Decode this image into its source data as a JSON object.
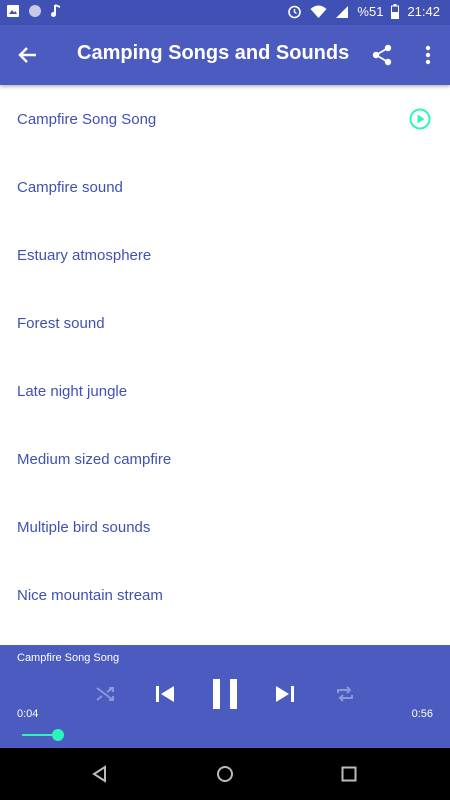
{
  "status_bar": {
    "battery_percent": "%51",
    "time": "21:42"
  },
  "app_bar": {
    "title": "Camping Songs and Sounds"
  },
  "list": {
    "items": [
      {
        "label": "Campfire Song Song",
        "playing": true
      },
      {
        "label": "Campfire sound"
      },
      {
        "label": "Estuary atmosphere"
      },
      {
        "label": "Forest sound"
      },
      {
        "label": "Late night jungle"
      },
      {
        "label": "Medium sized campfire"
      },
      {
        "label": "Multiple bird sounds"
      },
      {
        "label": "Nice mountain stream"
      }
    ]
  },
  "player": {
    "now_playing": "Campfire Song Song",
    "elapsed": "0:04",
    "duration": "0:56",
    "progress_fraction": 0.087
  },
  "colors": {
    "primary": "#4b5bbf",
    "text": "#3f51b5",
    "accent": "#2bf5b8"
  }
}
